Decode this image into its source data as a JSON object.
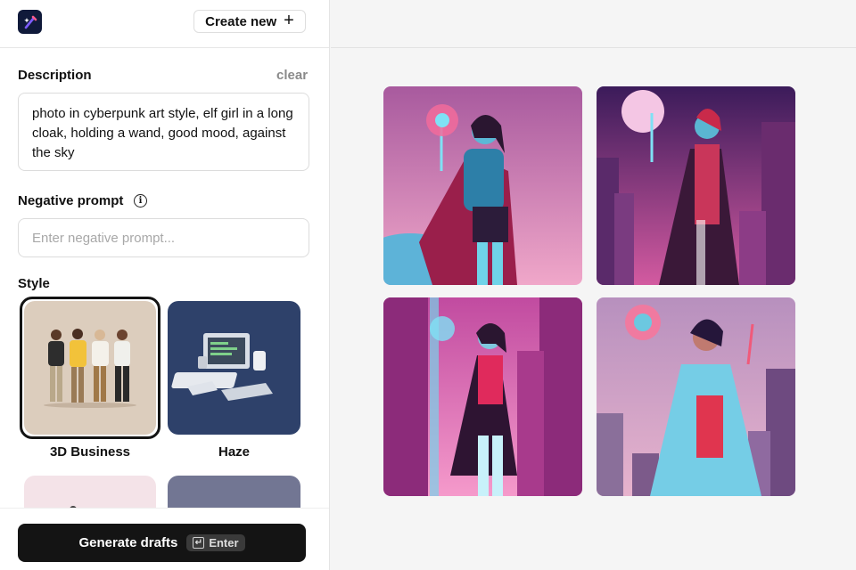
{
  "header": {
    "create_label": "Create new"
  },
  "description": {
    "label": "Description",
    "clear_label": "clear",
    "value": "photo in cyberpunk art style, elf girl in a long cloak, holding a wand, good mood, against the sky"
  },
  "negative_prompt": {
    "label": "Negative prompt",
    "placeholder": "Enter negative prompt..."
  },
  "style": {
    "label": "Style",
    "options": [
      {
        "label": "3D Business",
        "selected": true
      },
      {
        "label": "Haze",
        "selected": false
      }
    ]
  },
  "generate": {
    "label": "Generate drafts",
    "shortcut": "Enter"
  },
  "gallery": {
    "count": 4
  },
  "icons": {
    "logo": "sparkle-pen-icon",
    "create": "plus-icon",
    "info": "info-icon",
    "enter": "return-key-icon"
  },
  "colors": {
    "primary_button": "#141414",
    "logo_bg": "#101a3a",
    "haze_card": "#2e416a",
    "business_card": "#dccdbd"
  }
}
